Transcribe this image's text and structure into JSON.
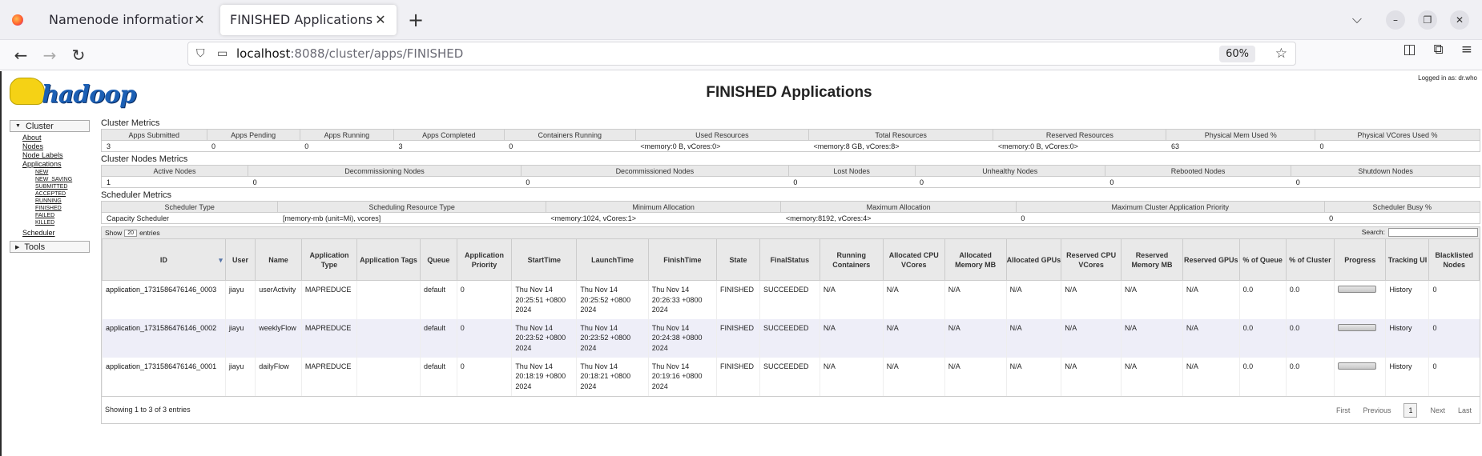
{
  "browser": {
    "tabs": [
      {
        "label": "Namenode information",
        "active": false
      },
      {
        "label": "FINISHED Applications",
        "active": true
      }
    ],
    "url_host": "localhost",
    "url_path": ":8088/cluster/apps/FINISHED",
    "zoom": "60%"
  },
  "page": {
    "title": "FINISHED Applications",
    "logged_in": "Logged in as: dr.who",
    "logo_text": "hadoop"
  },
  "sidebar": {
    "cluster_label": "Cluster",
    "links": [
      "About",
      "Nodes",
      "Node Labels",
      "Applications"
    ],
    "app_states": [
      "NEW",
      "NEW_SAVING",
      "SUBMITTED",
      "ACCEPTED",
      "RUNNING",
      "FINISHED",
      "FAILED",
      "KILLED"
    ],
    "scheduler": "Scheduler",
    "tools_label": "Tools"
  },
  "cluster_metrics": {
    "title": "Cluster Metrics",
    "headers": [
      "Apps Submitted",
      "Apps Pending",
      "Apps Running",
      "Apps Completed",
      "Containers Running",
      "Used Resources",
      "Total Resources",
      "Reserved Resources",
      "Physical Mem Used %",
      "Physical VCores Used %"
    ],
    "values": [
      "3",
      "0",
      "0",
      "3",
      "0",
      "<memory:0 B, vCores:0>",
      "<memory:8 GB, vCores:8>",
      "<memory:0 B, vCores:0>",
      "63",
      "0"
    ]
  },
  "nodes_metrics": {
    "title": "Cluster Nodes Metrics",
    "headers": [
      "Active Nodes",
      "Decommissioning Nodes",
      "Decommissioned Nodes",
      "Lost Nodes",
      "Unhealthy Nodes",
      "Rebooted Nodes",
      "Shutdown Nodes"
    ],
    "values": [
      "1",
      "0",
      "0",
      "0",
      "0",
      "0",
      "0"
    ]
  },
  "scheduler_metrics": {
    "title": "Scheduler Metrics",
    "headers": [
      "Scheduler Type",
      "Scheduling Resource Type",
      "Minimum Allocation",
      "Maximum Allocation",
      "Maximum Cluster Application Priority",
      "Scheduler Busy %"
    ],
    "values": [
      "Capacity Scheduler",
      "[memory-mb (unit=Mi), vcores]",
      "<memory:1024, vCores:1>",
      "<memory:8192, vCores:4>",
      "0",
      "0"
    ]
  },
  "apps_table": {
    "show_label": "Show",
    "show_value": "20",
    "entries_label": "entries",
    "search_label": "Search:",
    "headers": [
      "ID",
      "User",
      "Name",
      "Application Type",
      "Application Tags",
      "Queue",
      "Application Priority",
      "StartTime",
      "LaunchTime",
      "FinishTime",
      "State",
      "FinalStatus",
      "Running Containers",
      "Allocated CPU VCores",
      "Allocated Memory MB",
      "Allocated GPUs",
      "Reserved CPU VCores",
      "Reserved Memory MB",
      "Reserved GPUs",
      "% of Queue",
      "% of Cluster",
      "Progress",
      "Tracking UI",
      "Blacklisted Nodes"
    ],
    "rows": [
      {
        "id": "application_1731586476146_0003",
        "user": "jiayu",
        "name": "userActivity",
        "type": "MAPREDUCE",
        "tags": "",
        "queue": "default",
        "priority": "0",
        "start": "Thu Nov 14 20:25:51 +0800 2024",
        "launch": "Thu Nov 14 20:25:52 +0800 2024",
        "finish": "Thu Nov 14 20:26:33 +0800 2024",
        "state": "FINISHED",
        "final": "SUCCEEDED",
        "running": "N/A",
        "acpu": "N/A",
        "amem": "N/A",
        "agpu": "N/A",
        "rcpu": "N/A",
        "rmem": "N/A",
        "rgpu": "N/A",
        "pqueue": "0.0",
        "pcluster": "0.0",
        "progress": 1.0,
        "tracking": "History",
        "blacklisted": "0"
      },
      {
        "id": "application_1731586476146_0002",
        "user": "jiayu",
        "name": "weeklyFlow",
        "type": "MAPREDUCE",
        "tags": "",
        "queue": "default",
        "priority": "0",
        "start": "Thu Nov 14 20:23:52 +0800 2024",
        "launch": "Thu Nov 14 20:23:52 +0800 2024",
        "finish": "Thu Nov 14 20:24:38 +0800 2024",
        "state": "FINISHED",
        "final": "SUCCEEDED",
        "running": "N/A",
        "acpu": "N/A",
        "amem": "N/A",
        "agpu": "N/A",
        "rcpu": "N/A",
        "rmem": "N/A",
        "rgpu": "N/A",
        "pqueue": "0.0",
        "pcluster": "0.0",
        "progress": 1.0,
        "tracking": "History",
        "blacklisted": "0"
      },
      {
        "id": "application_1731586476146_0001",
        "user": "jiayu",
        "name": "dailyFlow",
        "type": "MAPREDUCE",
        "tags": "",
        "queue": "default",
        "priority": "0",
        "start": "Thu Nov 14 20:18:19 +0800 2024",
        "launch": "Thu Nov 14 20:18:21 +0800 2024",
        "finish": "Thu Nov 14 20:19:16 +0800 2024",
        "state": "FINISHED",
        "final": "SUCCEEDED",
        "running": "N/A",
        "acpu": "N/A",
        "amem": "N/A",
        "agpu": "N/A",
        "rcpu": "N/A",
        "rmem": "N/A",
        "rgpu": "N/A",
        "pqueue": "0.0",
        "pcluster": "0.0",
        "progress": 1.0,
        "tracking": "History",
        "blacklisted": "0"
      }
    ],
    "footer_info": "Showing 1 to 3 of 3 entries",
    "pager": {
      "first": "First",
      "previous": "Previous",
      "current": "1",
      "next": "Next",
      "last": "Last"
    }
  }
}
